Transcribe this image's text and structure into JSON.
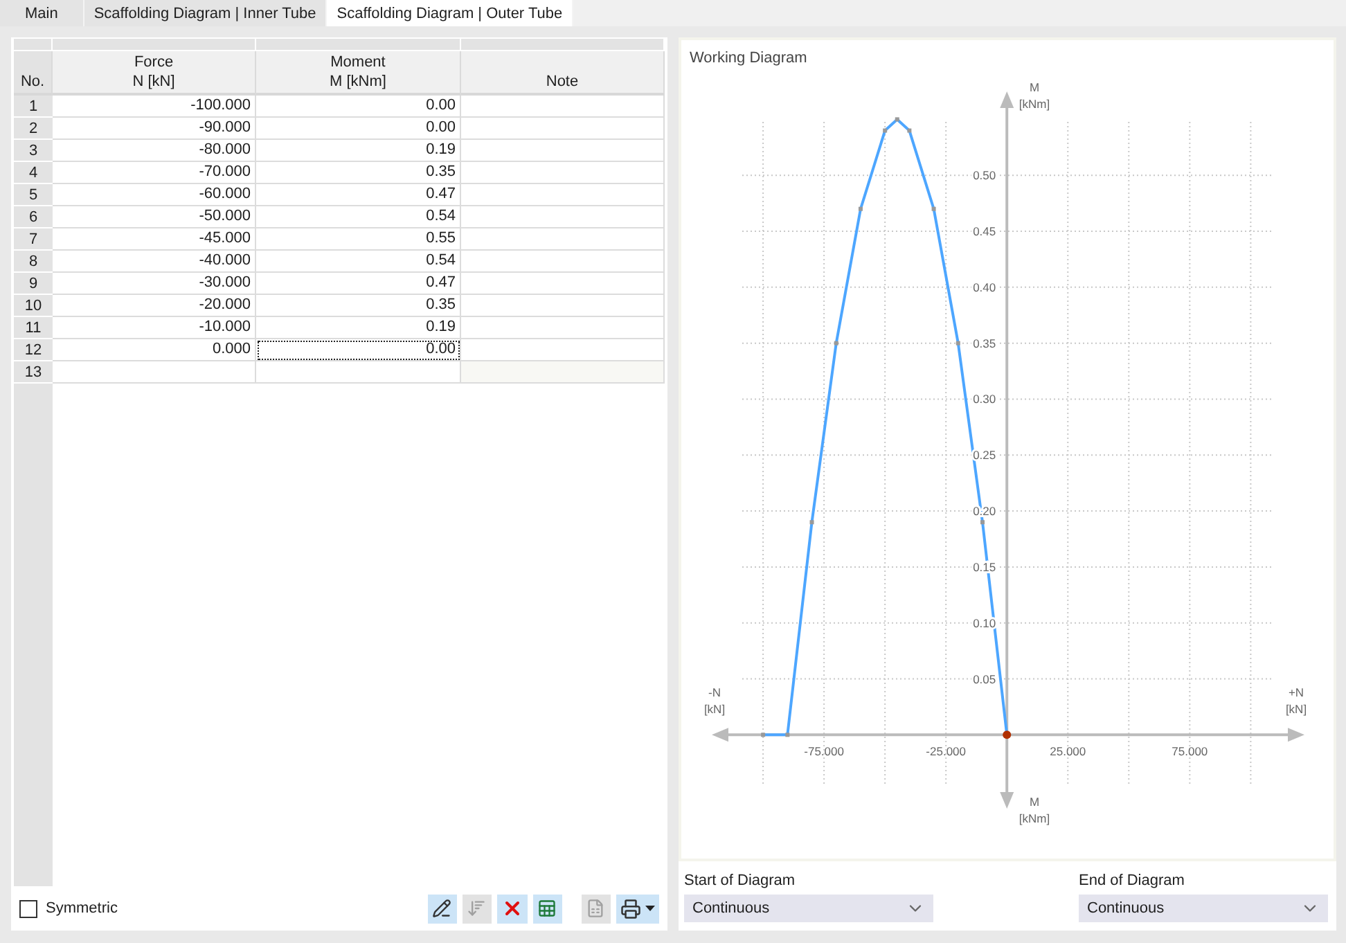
{
  "tabs": [
    {
      "label": "Main",
      "selected": false
    },
    {
      "label": "Scaffolding Diagram | Inner Tube",
      "selected": false
    },
    {
      "label": "Scaffolding Diagram | Outer Tube",
      "selected": true
    }
  ],
  "table": {
    "no_header": "No.",
    "columns": [
      {
        "lines": [
          "Force",
          "N [kN]"
        ]
      },
      {
        "lines": [
          "Moment",
          "M [kNm]"
        ]
      },
      {
        "lines": [
          "Note"
        ]
      }
    ],
    "rows": [
      {
        "no": "1",
        "force": "-100.000",
        "moment": "0.00",
        "focused": false
      },
      {
        "no": "2",
        "force": "-90.000",
        "moment": "0.00",
        "focused": false
      },
      {
        "no": "3",
        "force": "-80.000",
        "moment": "0.19",
        "focused": false
      },
      {
        "no": "4",
        "force": "-70.000",
        "moment": "0.35",
        "focused": false
      },
      {
        "no": "5",
        "force": "-60.000",
        "moment": "0.47",
        "focused": false
      },
      {
        "no": "6",
        "force": "-50.000",
        "moment": "0.54",
        "focused": false
      },
      {
        "no": "7",
        "force": "-45.000",
        "moment": "0.55",
        "focused": false
      },
      {
        "no": "8",
        "force": "-40.000",
        "moment": "0.54",
        "focused": false
      },
      {
        "no": "9",
        "force": "-30.000",
        "moment": "0.47",
        "focused": false
      },
      {
        "no": "10",
        "force": "-20.000",
        "moment": "0.35",
        "focused": false
      },
      {
        "no": "11",
        "force": "-10.000",
        "moment": "0.19",
        "focused": false
      },
      {
        "no": "12",
        "force": "0.000",
        "moment": "0.00",
        "focused": true
      },
      {
        "no": "13",
        "focused": false
      }
    ]
  },
  "symmetric": {
    "label": "Symmetric",
    "checked": false
  },
  "toolbar": [
    {
      "kind": "edit",
      "disabled": false
    },
    {
      "kind": "sort",
      "disabled": true
    },
    {
      "kind": "delete",
      "disabled": false
    },
    {
      "kind": "export",
      "disabled": false
    },
    {
      "kind": "import",
      "disabled": true
    },
    {
      "kind": "print",
      "disabled": false
    }
  ],
  "diagram": {
    "title": "Working Diagram",
    "axis_labels": {
      "top": {
        "name": "M",
        "unit": "[kNm]"
      },
      "bottom": {
        "name": "M",
        "unit": "[kNm]"
      },
      "left": {
        "name": "-N",
        "unit": "[kN]"
      },
      "right": {
        "name": "+N",
        "unit": "[kN]"
      }
    },
    "chart_data": {
      "type": "line",
      "grid": true,
      "xlim": [
        -116.5,
        117.5
      ],
      "ylim": [
        -0.0561,
        0.5651
      ],
      "x": [
        -100,
        -90,
        -80,
        -70,
        -60,
        -50,
        -45,
        -40,
        -30,
        -20,
        -10,
        0
      ],
      "series": [
        {
          "color": "#4da6ff",
          "marker": "square",
          "values": [
            0,
            0,
            0.19,
            0.35,
            0.47,
            0.54,
            0.55,
            0.54,
            0.47,
            0.35,
            0.19,
            0
          ]
        }
      ],
      "xticks": [
        {
          "value": -75,
          "label": "-75.000"
        },
        {
          "value": -25,
          "label": "-25.000"
        },
        {
          "value": 25,
          "label": "25.000"
        },
        {
          "value": 75,
          "label": "75.000"
        }
      ],
      "yticks": [
        {
          "value": 0.05,
          "label": "0.05"
        },
        {
          "value": 0.1,
          "label": "0.10"
        },
        {
          "value": 0.15,
          "label": "0.15"
        },
        {
          "value": 0.2,
          "label": "0.20"
        },
        {
          "value": 0.25,
          "label": "0.25"
        },
        {
          "value": 0.3,
          "label": "0.30"
        },
        {
          "value": 0.35,
          "label": "0.35"
        },
        {
          "value": 0.4,
          "label": "0.40"
        },
        {
          "value": 0.45,
          "label": "0.45"
        },
        {
          "value": 0.5,
          "label": "0.50"
        }
      ]
    }
  },
  "selects": [
    {
      "label": "Start of Diagram",
      "value": "Continuous"
    },
    {
      "label": "End of Diagram",
      "value": "Continuous"
    }
  ]
}
